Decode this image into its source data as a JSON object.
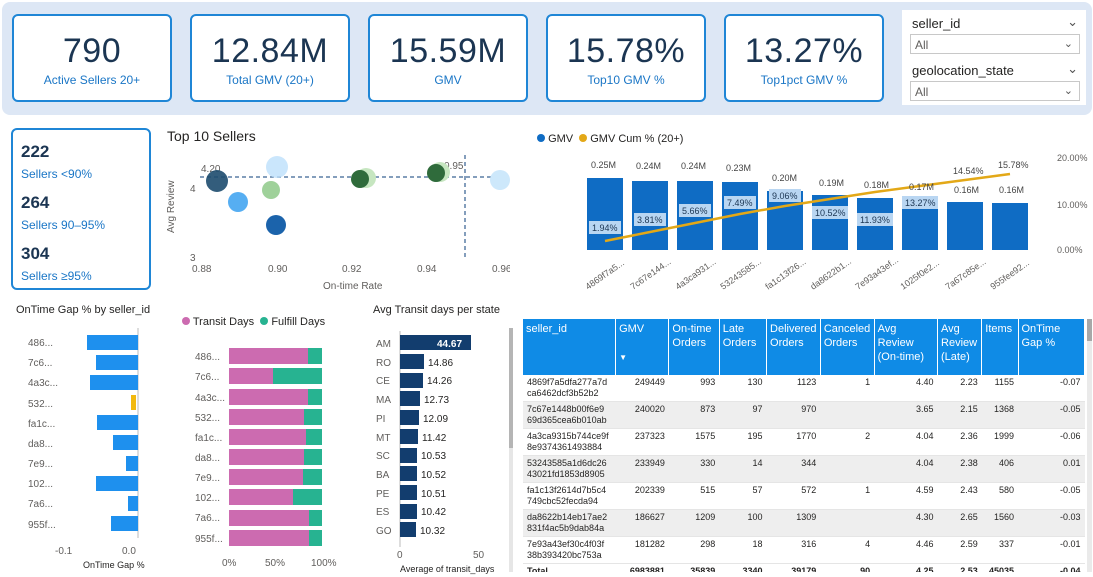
{
  "kpis": [
    {
      "value": "790",
      "label": "Active Sellers 20+"
    },
    {
      "value": "12.84M",
      "label": "Total GMV (20+)"
    },
    {
      "value": "15.59M",
      "label": "GMV"
    },
    {
      "value": "15.78%",
      "label": "Top10 GMV %"
    },
    {
      "value": "13.27%",
      "label": "Top1pct GMV %"
    }
  ],
  "slicers": [
    {
      "title": "seller_id",
      "value": "All"
    },
    {
      "title": "geolocation_state",
      "value": "All"
    }
  ],
  "seller_buckets": [
    {
      "count": "222",
      "label": "Sellers <90%"
    },
    {
      "count": "264",
      "label": "Sellers 90–95%"
    },
    {
      "count": "304",
      "label": "Sellers ≥95%"
    }
  ],
  "scatter": {
    "title": "Top 10 Sellers",
    "xlabel": "On-time Rate",
    "ylabel": "Avg Review",
    "xticks": [
      "0.88",
      "0.90",
      "0.92",
      "0.94",
      "0.96"
    ],
    "yticks": [
      "4",
      "3"
    ],
    "ref_y_label": "4.20",
    "ref_x_label": "0.95"
  },
  "combo": {
    "legend": [
      "GMV",
      "GMV Cum % (20+)"
    ],
    "categories": [
      "4869f7a5...",
      "7c67e144...",
      "4a3ca931...",
      "53243585...",
      "fa1c13f26...",
      "da8622b1...",
      "7e93a43ef...",
      "1025f0e2...",
      "7a67c85e...",
      "955fee92..."
    ],
    "bar_labels": [
      "0.25M",
      "0.24M",
      "0.24M",
      "0.23M",
      "0.20M",
      "0.19M",
      "0.18M",
      "0.17M",
      "0.16M",
      "0.16M"
    ],
    "cum_labels": [
      "1.94%",
      "3.81%",
      "5.66%",
      "7.49%",
      "9.06%",
      "10.52%",
      "11.93%",
      "13.27%",
      "14.54%",
      "15.78%"
    ],
    "right_ticks": [
      "20.00%",
      "10.00%",
      "0.00%"
    ]
  },
  "gap_chart": {
    "title": "OnTime Gap % by seller_id",
    "xlabel": "OnTime Gap %",
    "labels": [
      "486...",
      "7c6...",
      "4a3c...",
      "532...",
      "fa1c...",
      "da8...",
      "7e9...",
      "102...",
      "7a6...",
      "955f..."
    ],
    "xticks": [
      "-0.1",
      "0.0"
    ]
  },
  "transit_chart": {
    "legend": [
      "Transit Days",
      "Fulfill Days"
    ],
    "labels": [
      "486...",
      "7c6...",
      "4a3c...",
      "532...",
      "fa1c...",
      "da8...",
      "7e9...",
      "102...",
      "7a6...",
      "955f..."
    ],
    "xticks": [
      "0%",
      "50%",
      "100%"
    ]
  },
  "state_chart": {
    "title": "Avg Transit days per state",
    "xlabel": "Average of transit_days",
    "xticks": [
      "0",
      "50"
    ],
    "states": [
      "AM",
      "RO",
      "CE",
      "MA",
      "PI",
      "MT",
      "SC",
      "BA",
      "PE",
      "ES",
      "GO"
    ],
    "value_labels": [
      "44.67",
      "14.86",
      "14.26",
      "12.73",
      "12.09",
      "11.42",
      "10.53",
      "10.52",
      "10.51",
      "10.42",
      "10.32"
    ]
  },
  "table": {
    "headers": [
      "seller_id",
      "GMV",
      "On-time Orders",
      "Late Orders",
      "Delivered Orders",
      "Canceled Orders",
      "Avg Review (On-time)",
      "Avg Review (Late)",
      "Items",
      "OnTime Gap %"
    ],
    "rows": [
      [
        "4869f7a5dfa277a7d ca6462dcf3b52b2",
        "249449",
        "993",
        "130",
        "1123",
        "1",
        "4.40",
        "2.23",
        "1155",
        "-0.07"
      ],
      [
        "7c67e1448b00f6e9 69d365cea6b010ab",
        "240020",
        "873",
        "97",
        "970",
        "",
        "3.65",
        "2.15",
        "1368",
        "-0.05"
      ],
      [
        "4a3ca9315b744ce9f 8e9374361493884",
        "237323",
        "1575",
        "195",
        "1770",
        "2",
        "4.04",
        "2.36",
        "1999",
        "-0.06"
      ],
      [
        "53243585a1d6dc26 43021fd1853d8905",
        "233949",
        "330",
        "14",
        "344",
        "",
        "4.04",
        "2.38",
        "406",
        "0.01"
      ],
      [
        "fa1c13f2614d7b5c4 749cbc52fecda94",
        "202339",
        "515",
        "57",
        "572",
        "1",
        "4.59",
        "2.43",
        "580",
        "-0.05"
      ],
      [
        "da8622b14eb17ae2 831f4ac5b9dab84a",
        "186627",
        "1209",
        "100",
        "1309",
        "",
        "4.30",
        "2.65",
        "1560",
        "-0.03"
      ],
      [
        "7e93a43ef30c4f03f 38b393420bc753a",
        "181282",
        "298",
        "18",
        "316",
        "4",
        "4.46",
        "2.59",
        "337",
        "-0.01"
      ]
    ],
    "total": [
      "Total",
      "6983881",
      "35839",
      "3340",
      "39179",
      "90",
      "4.25",
      "2.53",
      "45035",
      "-0.04"
    ]
  },
  "colors": {
    "accent": "#1f86d6",
    "bar_blue": "#0f6cc4",
    "cum_line": "#e3a817",
    "pink": "#cc6bb0",
    "teal": "#27b391",
    "navy": "#123d6e"
  }
}
